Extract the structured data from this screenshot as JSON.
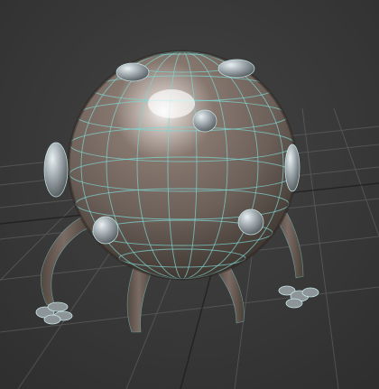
{
  "viewport": {
    "background_color": "#3d3d3d",
    "grid_color": "#6a6a6a",
    "grid_axis_color": "#1a1a1a"
  },
  "model": {
    "body_color": "#6b5f58",
    "wireframe_color": "#7fd6d2",
    "highlight_color": "#ffffff",
    "nub_color": "#9aa3a8",
    "limb_color": "#6a5d57"
  }
}
